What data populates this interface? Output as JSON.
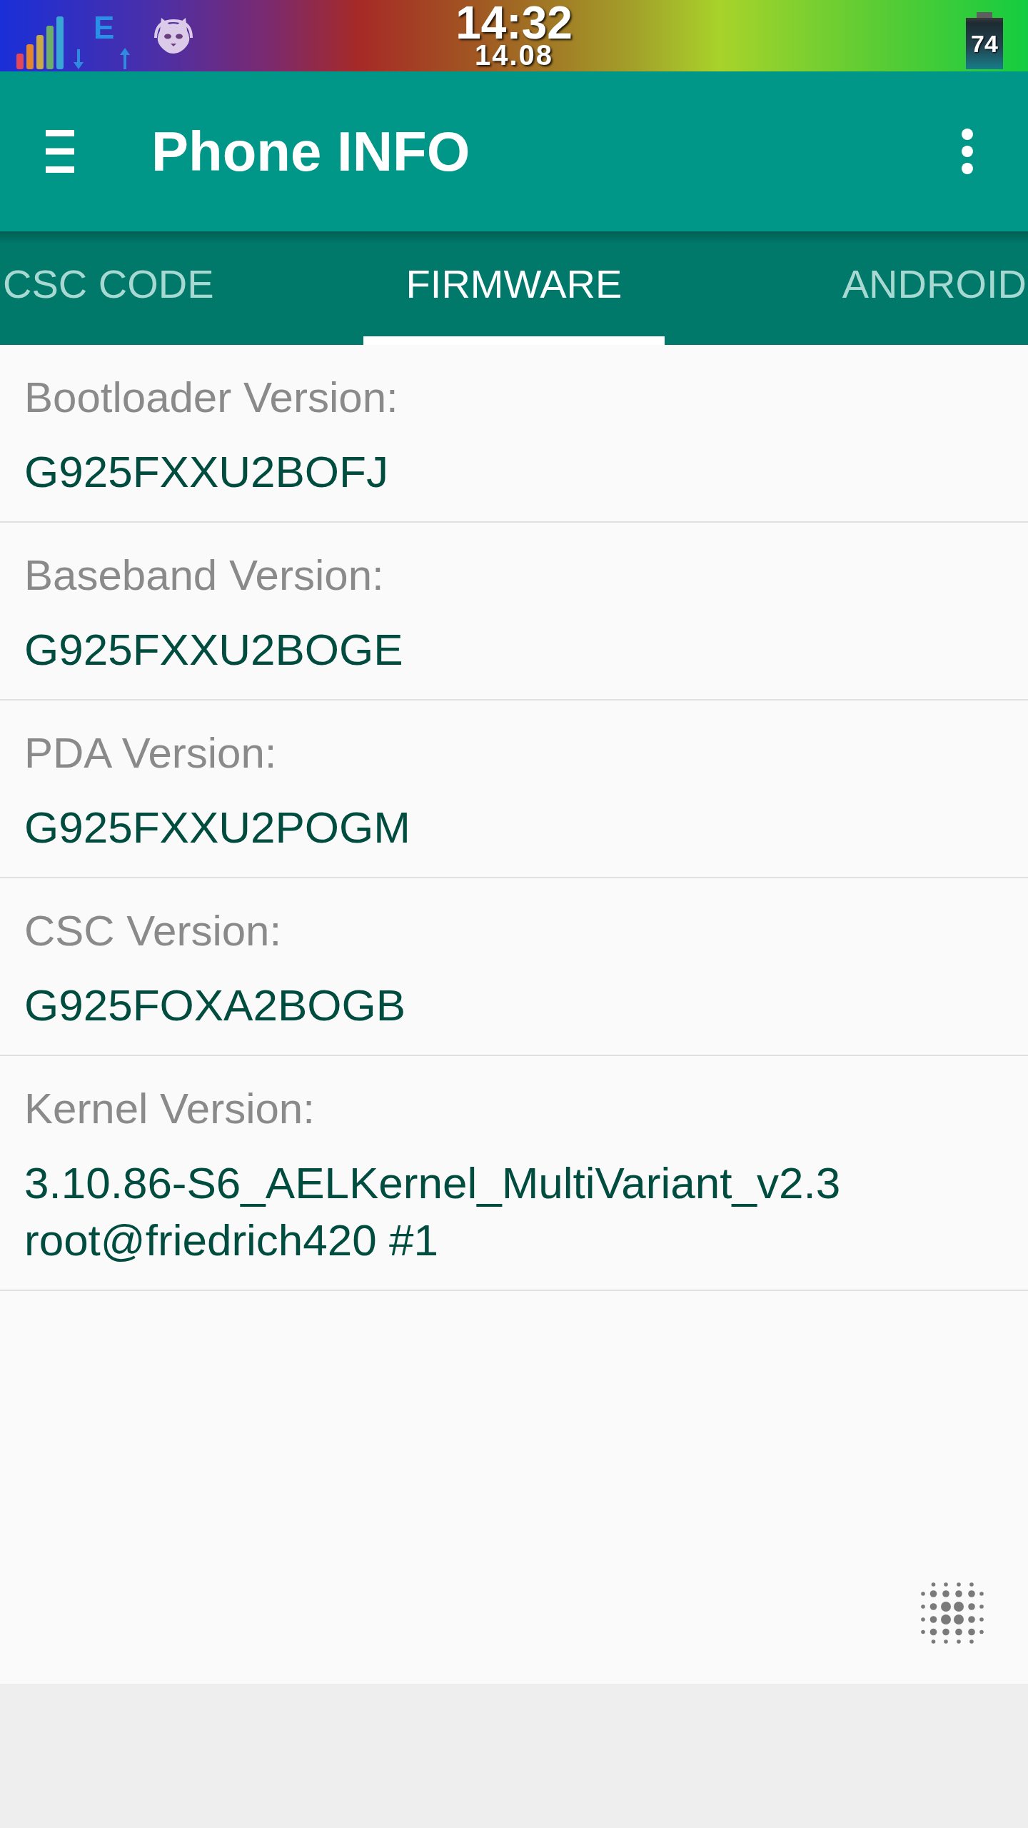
{
  "status_bar": {
    "network_type": "E",
    "time": "14:32",
    "date": "14.08",
    "battery": "74"
  },
  "toolbar": {
    "title": "Phone INFO"
  },
  "tabs": [
    {
      "label": "CSC CODE",
      "selected": false
    },
    {
      "label": "FIRMWARE",
      "selected": true
    },
    {
      "label": "ANDROID",
      "selected": false
    }
  ],
  "fields": [
    {
      "label": "Bootloader Version:",
      "value": "G925FXXU2BOFJ"
    },
    {
      "label": "Baseband Version:",
      "value": "G925FXXU2BOGE"
    },
    {
      "label": "PDA Version:",
      "value": "G925FXXU2POGM"
    },
    {
      "label": "CSC Version:",
      "value": "G925FOXA2BOGB"
    },
    {
      "label": "Kernel Version:",
      "value": "3.10.86-S6_AELKernel_MultiVariant_v2.3 root@friedrich420 #1"
    }
  ]
}
